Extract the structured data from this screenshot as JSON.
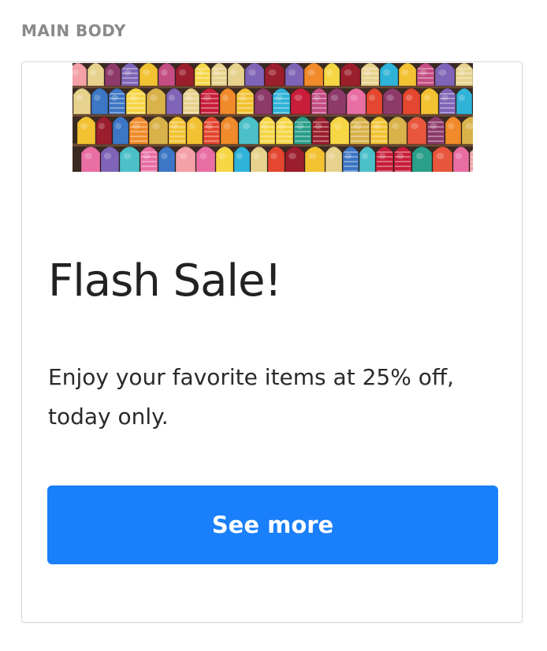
{
  "section": {
    "label": "MAIN BODY"
  },
  "card": {
    "hero_image": "colorful-slippers-photo",
    "headline": "Flash Sale!",
    "body": "Enjoy your favorite items at 25% off, today only.",
    "cta_label": "See more"
  },
  "colors": {
    "button_bg": "#1a7ffa",
    "headline_text": "#222222",
    "label_text": "#8a8a8a"
  }
}
